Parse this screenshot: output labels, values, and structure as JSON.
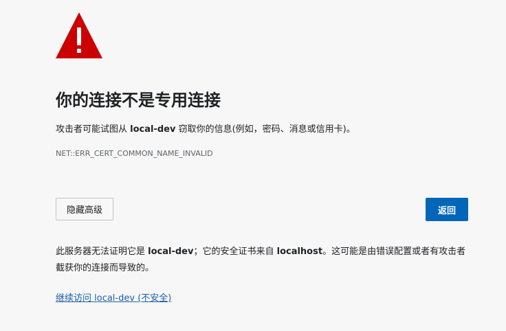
{
  "warning": {
    "icon": "warning-triangle-icon",
    "color": "#cc0000"
  },
  "title": "你的连接不是专用连接",
  "description": {
    "prefix": "攻击者可能试图从 ",
    "host": "local-dev",
    "suffix": " 窃取你的信息(例如，密码、消息或信用卡)。"
  },
  "error_code": "NET::ERR_CERT_COMMON_NAME_INVALID",
  "buttons": {
    "advanced_label": "隐藏高级",
    "back_label": "返回",
    "back_color": "#0067b8"
  },
  "details": {
    "part1": "此服务器无法证明它是 ",
    "host": "local-dev",
    "part2": "；它的安全证书来自 ",
    "issuer": "localhost",
    "part3": "。这可能是由错误配置或者有攻击者截获你的连接而导致的。"
  },
  "proceed_link": "继续访问 local-dev (不安全)"
}
